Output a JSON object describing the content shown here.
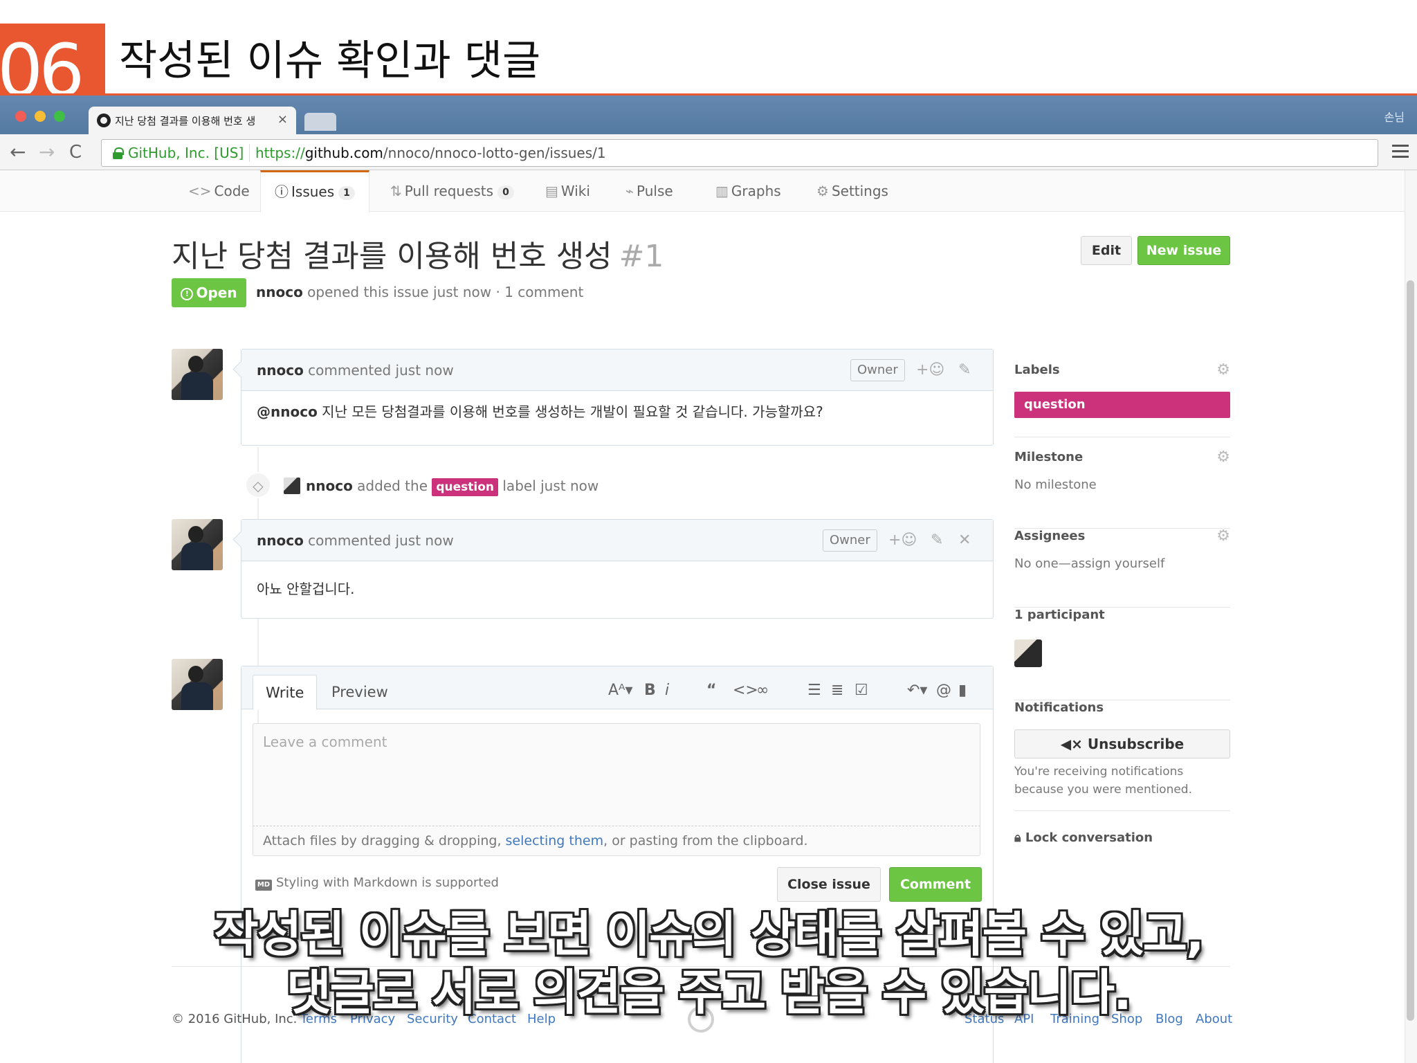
{
  "slide": {
    "number": "06",
    "title": "작성된 이슈 확인과 댓글",
    "accent": "#e8572f"
  },
  "browser": {
    "tab_title": "지난 당첨 결과를 이용해 번호 생",
    "tab_close": "×",
    "profile": "손님",
    "ev_cert": "GitHub, Inc. [US]",
    "url_scheme": "https://",
    "url_host": "github.com",
    "url_path": "/nnoco/nnoco-lotto-gen/issues/1",
    "back": "←",
    "forward": "→",
    "reload": "C"
  },
  "reponav": {
    "code": "Code",
    "issues": "Issues",
    "issues_count": "1",
    "pulls": "Pull requests",
    "pulls_count": "0",
    "wiki": "Wiki",
    "pulse": "Pulse",
    "graphs": "Graphs",
    "settings": "Settings"
  },
  "issue": {
    "title": "지난 당첨 결과를 이용해 번호 생성",
    "number": "#1",
    "edit_label": "Edit",
    "new_issue_label": "New issue",
    "state": "Open",
    "author": "nnoco",
    "meta": "opened this issue just now · 1 comment"
  },
  "comments": [
    {
      "author": "nnoco",
      "when": "commented just now",
      "owner": "Owner",
      "mention": "@nnoco",
      "body": "지난 모든 당첨결과를 이용해 번호를 생성하는 개발이 필요할 것 같습니다. 가능할까요?"
    },
    {
      "author": "nnoco",
      "when": "commented just now",
      "owner": "Owner",
      "mention": "",
      "body": "아뇨 안할겁니다."
    }
  ],
  "event": {
    "actor": "nnoco",
    "pre": "added the",
    "label": "question",
    "post": "label just now"
  },
  "form": {
    "tab_write": "Write",
    "tab_preview": "Preview",
    "placeholder": "Leave a comment",
    "drop_pre": "Attach files by dragging & dropping, ",
    "drop_link": "selecting them",
    "drop_post": ", or pasting from the clipboard.",
    "md_badge": "MD",
    "md_hint": "Styling with Markdown is supported",
    "close_label": "Close issue",
    "comment_label": "Comment"
  },
  "sidebar": {
    "labels_head": "Labels",
    "label": "question",
    "label_color": "#cc317c",
    "milestone_head": "Milestone",
    "milestone_val": "No milestone",
    "assignees_head": "Assignees",
    "assignees_val": "No one—assign yourself",
    "participants_head": "1 participant",
    "notifications_head": "Notifications",
    "unsubscribe_label": "Unsubscribe",
    "notif_reason": "You're receiving notifications because you were mentioned.",
    "lock_label": "Lock conversation"
  },
  "footer": {
    "copyright": "© 2016 GitHub, Inc.",
    "links_left": [
      "Terms",
      "Privacy",
      "Security",
      "Contact",
      "Help"
    ],
    "links_right": [
      "Status",
      "API",
      "Training",
      "Shop",
      "Blog",
      "About"
    ]
  },
  "subtitle": {
    "line1": "작성된 이슈를 보면 이슈의 상태를 살펴볼 수 있고,",
    "line2": "댓글로 서로 의견을 주고 받을 수 있습니다."
  },
  "colors": {
    "green": "#6cc644",
    "link": "#4078c0",
    "tab_accent": "#d26911"
  }
}
